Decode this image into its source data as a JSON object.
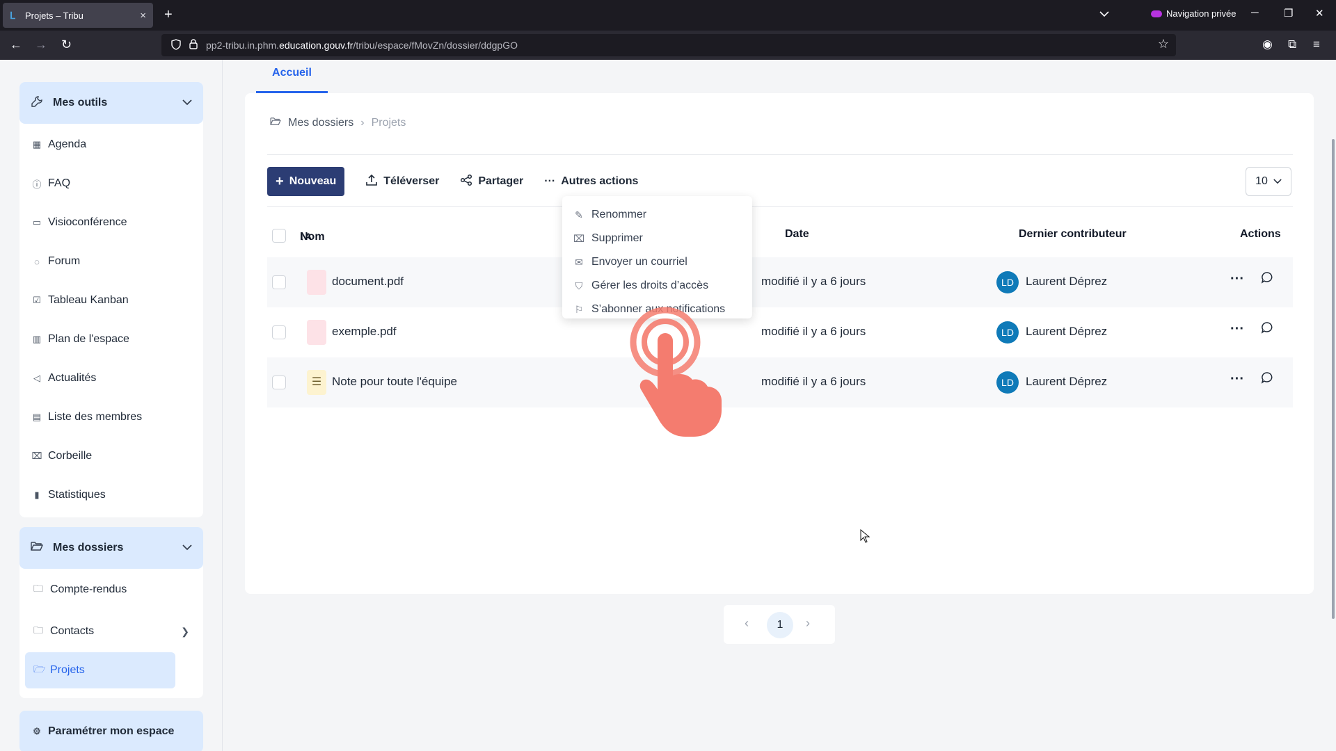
{
  "browser": {
    "tab_title": "Projets – Tribu",
    "tab_close": "×",
    "new_tab": "+",
    "private_label": "Navigation privée",
    "url_prefix": "pp2-tribu.in.phm.",
    "url_domain": "education.gouv.fr",
    "url_path": "/tribu/espace/fMovZn/dossier/ddgpGO"
  },
  "sidebar": {
    "tools_header": "Mes outils",
    "tools": [
      {
        "label": "Agenda",
        "icon": "calendar-icon"
      },
      {
        "label": "FAQ",
        "icon": "help-icon"
      },
      {
        "label": "Visioconférence",
        "icon": "video-icon"
      },
      {
        "label": "Forum",
        "icon": "forum-icon"
      },
      {
        "label": "Tableau Kanban",
        "icon": "kanban-icon"
      },
      {
        "label": "Plan de l'espace",
        "icon": "map-icon"
      },
      {
        "label": "Actualités",
        "icon": "megaphone-icon"
      },
      {
        "label": "Liste des membres",
        "icon": "members-icon"
      },
      {
        "label": "Corbeille",
        "icon": "trash-icon"
      },
      {
        "label": "Statistiques",
        "icon": "chart-icon"
      }
    ],
    "folders_header": "Mes dossiers",
    "folders": [
      {
        "label": "Compte-rendus"
      },
      {
        "label": "Contacts"
      },
      {
        "label": "Projets"
      }
    ],
    "settings_label": "Paramétrer mon espace"
  },
  "main": {
    "home_tab": "Accueil",
    "breadcrumb": {
      "root": "Mes dossiers",
      "current": "Projets"
    },
    "toolbar": {
      "new_label": "Nouveau",
      "upload_label": "Téléverser",
      "share_label": "Partager",
      "more_label": "Autres actions",
      "page_size": "10"
    },
    "columns": {
      "name": "Nom",
      "date": "Date",
      "contributor": "Dernier contributeur",
      "actions": "Actions"
    },
    "rows": [
      {
        "name": "document.pdf",
        "date": "modifié il y a 6 jours",
        "initials": "LD",
        "contributor": "Laurent Déprez"
      },
      {
        "name": "exemple.pdf",
        "date": "modifié il y a 6 jours",
        "initials": "LD",
        "contributor": "Laurent Déprez"
      },
      {
        "name": "Note pour toute l'équipe",
        "date": "modifié il y a 6 jours",
        "initials": "LD",
        "contributor": "Laurent Déprez"
      }
    ],
    "dropdown": [
      {
        "label": "Renommer",
        "icon": "edit-icon"
      },
      {
        "label": "Supprimer",
        "icon": "trash-icon"
      },
      {
        "label": "Envoyer un courriel",
        "icon": "mail-icon"
      },
      {
        "label": "Gérer les droits d’accès",
        "icon": "shield-icon"
      },
      {
        "label": "S’abonner aux notifications",
        "icon": "flag-icon"
      }
    ],
    "pagination": {
      "current": "1"
    }
  },
  "colors": {
    "primary_button": "#2c3d74",
    "accent": "#2563eb",
    "sidebar_header": "#dbeafe",
    "avatar": "#0f7ab8",
    "hand_overlay": "#f47c6f"
  }
}
